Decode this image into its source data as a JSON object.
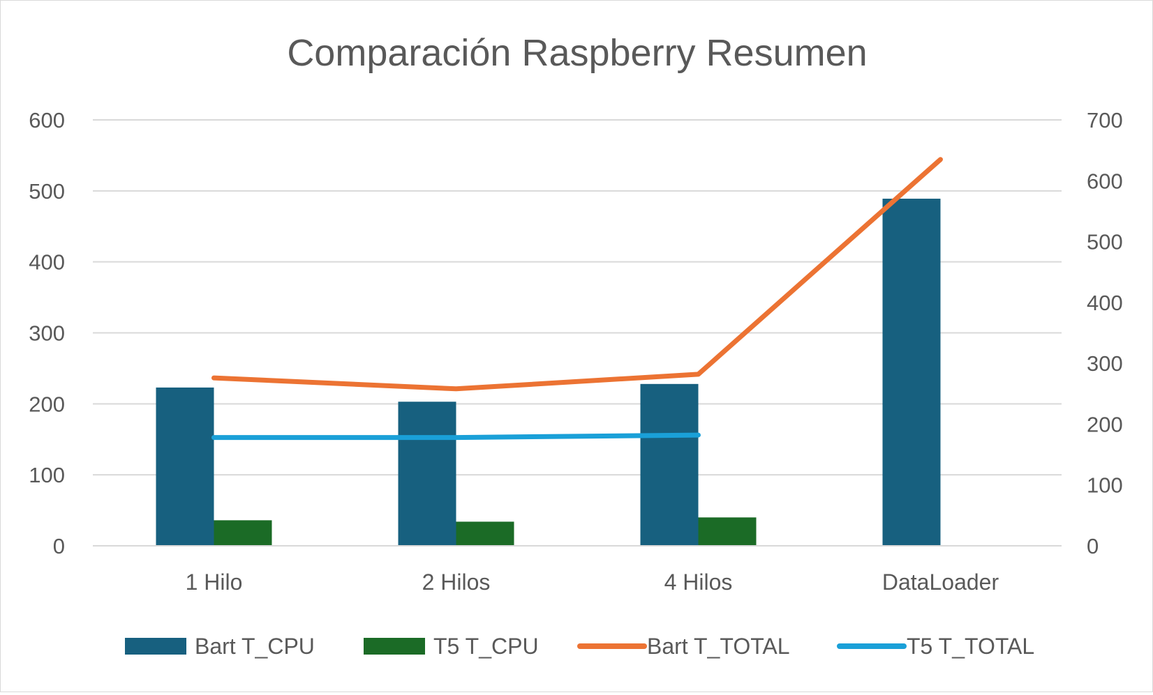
{
  "chart_data": {
    "type": "bar",
    "title": "Comparación Raspberry Resumen",
    "categories": [
      "1 Hilo",
      "2 Hilos",
      "4 Hilos",
      "DataLoader"
    ],
    "y_left": {
      "min": 0,
      "max": 600,
      "ticks": [
        "0",
        "100",
        "200",
        "300",
        "400",
        "500",
        "600"
      ]
    },
    "y_right": {
      "min": 0,
      "max": 700,
      "ticks": [
        "0",
        "100",
        "200",
        "300",
        "400",
        "500",
        "600",
        "700"
      ]
    },
    "gridlines": true,
    "legend_position": "bottom",
    "series": [
      {
        "name": "Bart T_CPU",
        "kind": "bar",
        "axis": "left",
        "color": "#17607f",
        "values": [
          223,
          203,
          228,
          489
        ]
      },
      {
        "name": "T5 T_CPU",
        "kind": "bar",
        "axis": "left",
        "color": "#1b6b26",
        "values": [
          36,
          34,
          40,
          null
        ]
      },
      {
        "name": "Bart T_TOTAL",
        "kind": "line",
        "axis": "right",
        "color": "#ec7333",
        "values": [
          276,
          258,
          282,
          635
        ]
      },
      {
        "name": "T5 T_TOTAL",
        "kind": "line",
        "axis": "right",
        "color": "#1aa0d8",
        "values": [
          178,
          178,
          182,
          null
        ]
      }
    ]
  }
}
